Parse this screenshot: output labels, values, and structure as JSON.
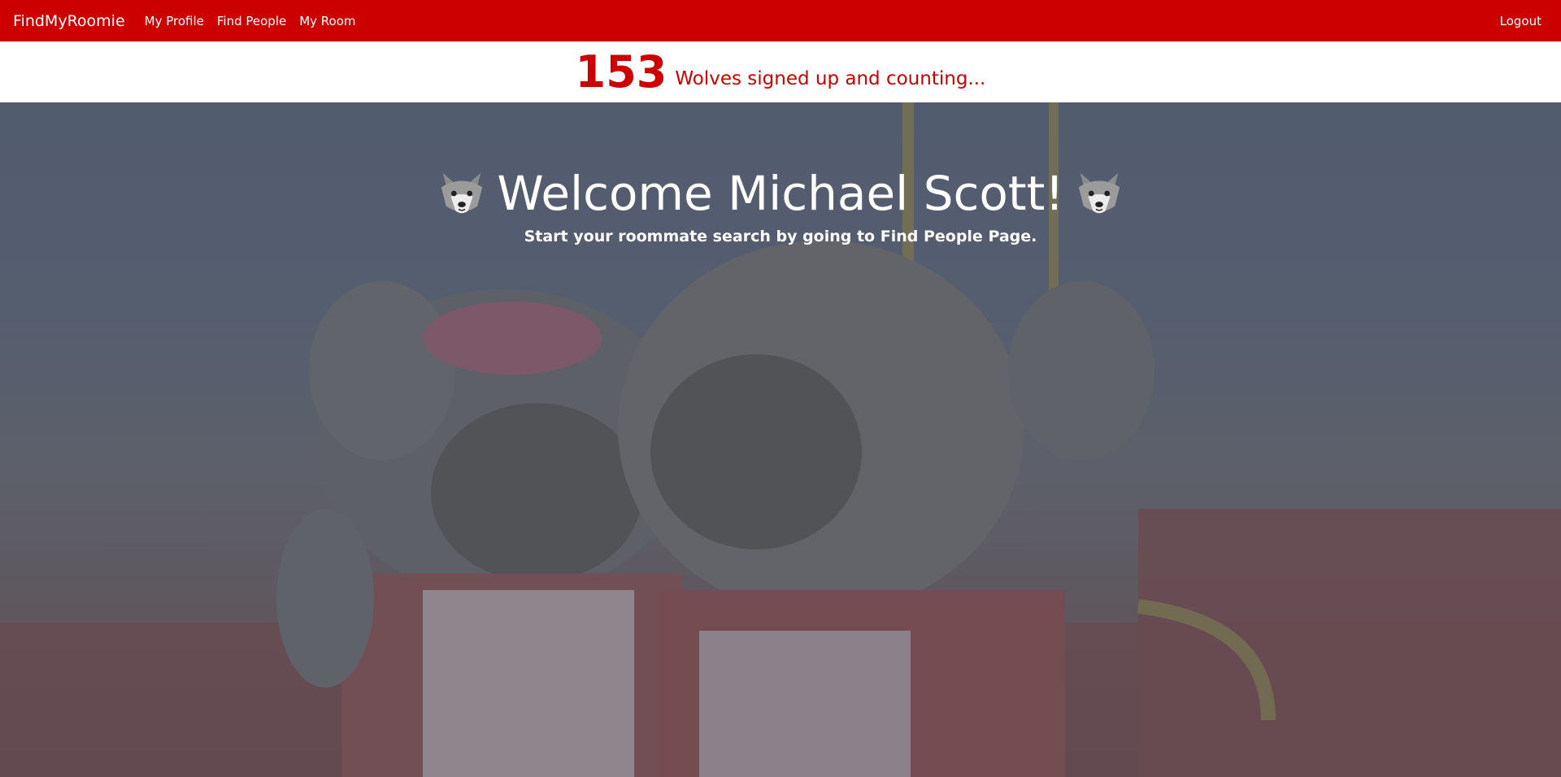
{
  "navbar": {
    "brand": "FindMyRoomie",
    "links": [
      {
        "label": "My Profile"
      },
      {
        "label": "Find People"
      },
      {
        "label": "My Room"
      }
    ],
    "logout": "Logout",
    "color": "#cc0000"
  },
  "counter": {
    "value": "153",
    "text": "Wolves signed up and counting..."
  },
  "hero": {
    "title": "Welcome Michael Scott!",
    "subtitle": "Start your roommate search by going to Find People Page.",
    "icons": [
      "wolf-face-icon",
      "wolf-face-icon"
    ],
    "background": "mascots-photo"
  }
}
